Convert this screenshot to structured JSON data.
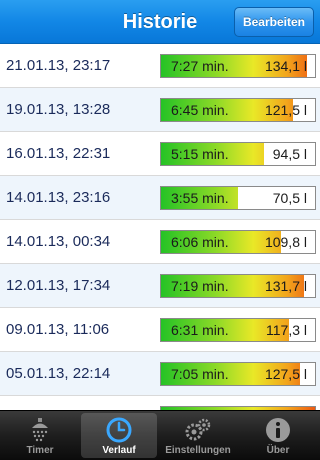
{
  "navbar": {
    "title": "Historie",
    "edit_button": "Bearbeiten"
  },
  "history": [
    {
      "date": "21.01.13, 23:17",
      "duration": "7:27 min.",
      "volume": "134,1 l",
      "fill": 0.95
    },
    {
      "date": "19.01.13, 13:28",
      "duration": "6:45 min.",
      "volume": "121,5 l",
      "fill": 0.86
    },
    {
      "date": "16.01.13, 22:31",
      "duration": "5:15 min.",
      "volume": "94,5 l",
      "fill": 0.67
    },
    {
      "date": "14.01.13, 23:16",
      "duration": "3:55 min.",
      "volume": "70,5 l",
      "fill": 0.5
    },
    {
      "date": "14.01.13, 00:34",
      "duration": "6:06 min.",
      "volume": "109,8 l",
      "fill": 0.78
    },
    {
      "date": "12.01.13, 17:34",
      "duration": "7:19 min.",
      "volume": "131,7 l",
      "fill": 0.93
    },
    {
      "date": "09.01.13, 11:06",
      "duration": "6:31 min.",
      "volume": "117,3 l",
      "fill": 0.83
    },
    {
      "date": "05.01.13, 22:14",
      "duration": "7:05 min.",
      "volume": "127,5 l",
      "fill": 0.9
    }
  ],
  "tabbar": {
    "tabs": [
      {
        "label": "Timer",
        "icon": "shower-icon"
      },
      {
        "label": "Verlauf",
        "icon": "clock-icon"
      },
      {
        "label": "Einstellungen",
        "icon": "gears-icon"
      },
      {
        "label": "Über",
        "icon": "info-icon"
      }
    ],
    "active": "Verlauf"
  },
  "colors": {
    "accent": "#1287e6",
    "bar_green": "#25c226",
    "bar_orange": "#ee5a12"
  }
}
